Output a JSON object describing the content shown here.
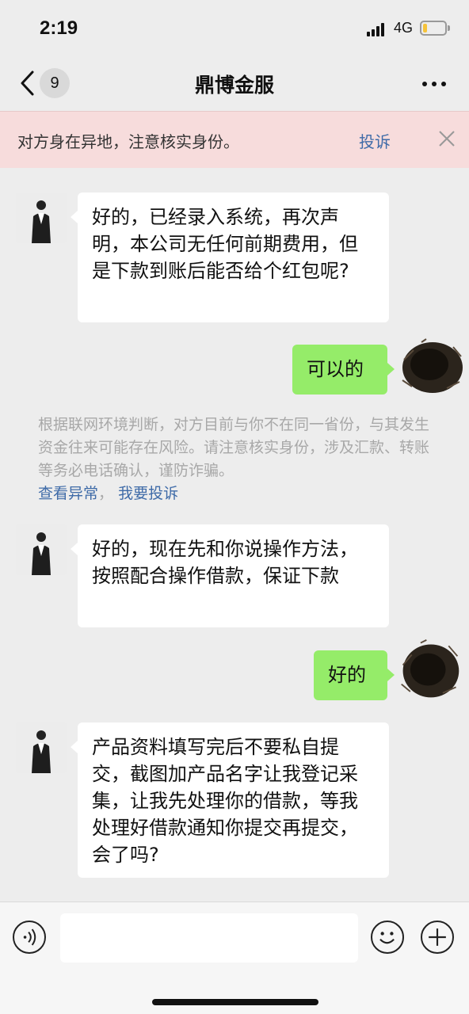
{
  "status_bar": {
    "time": "2:19",
    "network": "4G",
    "battery_level": 0.2
  },
  "nav": {
    "unread_count": "9",
    "title": "鼎博金服"
  },
  "warning": {
    "text": "对方身在异地，注意核实身份。",
    "report_label": "投诉"
  },
  "messages": [
    {
      "side": "left",
      "text": "好的，已经录入系统，再次声明，本公司无任何前期费用，但是下款到账后能否给个红包呢?"
    },
    {
      "side": "right",
      "text": "可以的"
    },
    {
      "side": "left",
      "text": "好的，现在先和你说操作方法，按照配合操作借款，保证下款"
    },
    {
      "side": "right",
      "text": "好的"
    },
    {
      "side": "left",
      "text": "产品资料填写完后不要私自提交，截图加产品名字让我登记采集，让我先处理你的借款，等我处理好借款通知你提交再提交，会了吗?"
    }
  ],
  "system_notice": {
    "text": "根据联网环境判断，对方目前与你不在同一省份，与其发生资金往来可能存在风险。请注意核实身份，涉及汇款、转账等务必电话确认，谨防诈骗。",
    "link_abnormal": "查看异常",
    "link_report": "我要投诉"
  },
  "input_bar": {
    "voice_icon": "voice-icon",
    "emoji_icon": "emoji-icon",
    "plus_icon": "plus-icon"
  },
  "colors": {
    "self_bubble": "#95ec69",
    "link": "#3f6ba8",
    "warning_bg": "#f7dcdc"
  }
}
